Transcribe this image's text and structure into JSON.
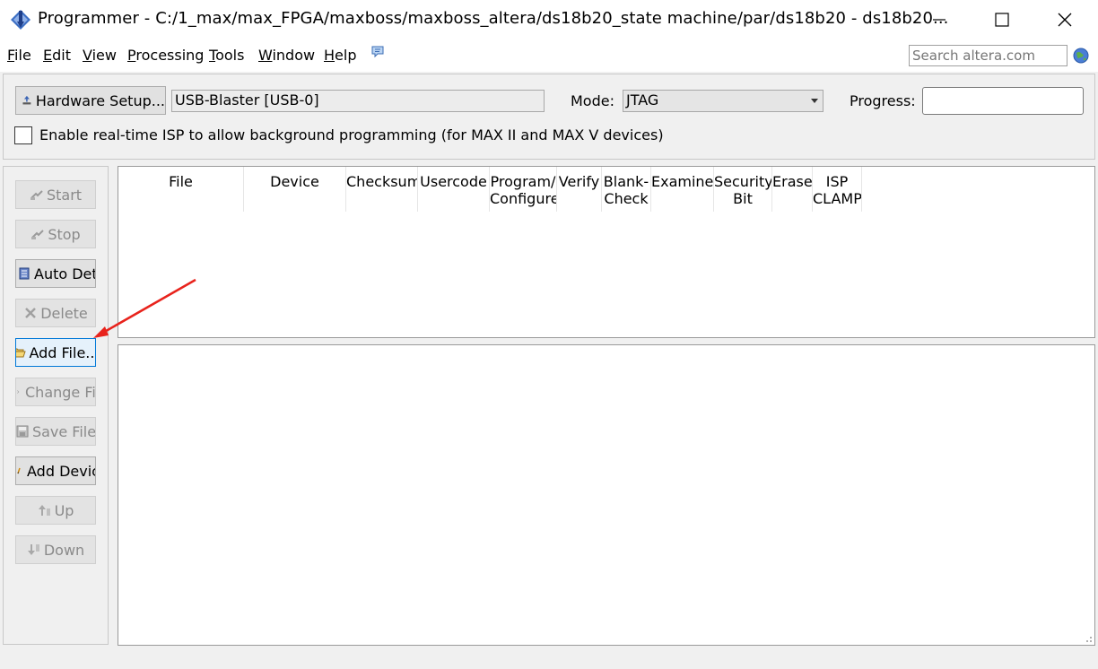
{
  "window": {
    "title": "Programmer - C:/1_max/max_FPGA/maxboss/maxboss_altera/ds18b20_state machine/par/ds18b20 - ds18b20..."
  },
  "menu": {
    "items": [
      {
        "first": "F",
        "rest": "ile"
      },
      {
        "first": "E",
        "rest": "dit"
      },
      {
        "first": "V",
        "rest": "iew"
      },
      {
        "first": "P",
        "rest": "rocessing"
      },
      {
        "first": "T",
        "rest": "ools"
      },
      {
        "first": "W",
        "rest": "indow"
      },
      {
        "first": "H",
        "rest": "elp"
      }
    ]
  },
  "search": {
    "placeholder": "Search altera.com"
  },
  "toolbar": {
    "hardware_setup_label": "Hardware Setup...",
    "hardware_value": "USB-Blaster [USB-0]",
    "mode_label": "Mode:",
    "mode_value": "JTAG",
    "progress_label": "Progress:",
    "isp_label": "Enable real-time ISP to allow background programming (for MAX II and MAX V devices)"
  },
  "side_buttons": {
    "start": "Start",
    "stop": "Stop",
    "auto_detect": "Auto Detect",
    "delete": "Delete",
    "add_file": "Add File...",
    "change_file": "Change File...",
    "save_file": "Save File",
    "add_device": "Add Device...",
    "up": "Up",
    "down": "Down"
  },
  "table": {
    "columns": [
      "File",
      "Device",
      "Checksum",
      "Usercode",
      "Program/\nConfigure",
      "Verify",
      "Blank-\nCheck",
      "Examine",
      "Security\nBit",
      "Erase",
      "ISP\nCLAMP"
    ]
  },
  "colors": {
    "annotation_arrow": "#e8231c",
    "focus_border": "#0078d7"
  },
  "icons": [
    "programmer-app-icon",
    "minimize-icon",
    "maximize-icon",
    "close-icon",
    "help-bubble-icon",
    "globe-icon",
    "hardware-icon",
    "start-icon",
    "stop-icon",
    "auto-detect-icon",
    "delete-icon",
    "folder-open-icon",
    "change-file-icon",
    "save-icon",
    "add-device-icon",
    "up-icon",
    "down-icon"
  ]
}
